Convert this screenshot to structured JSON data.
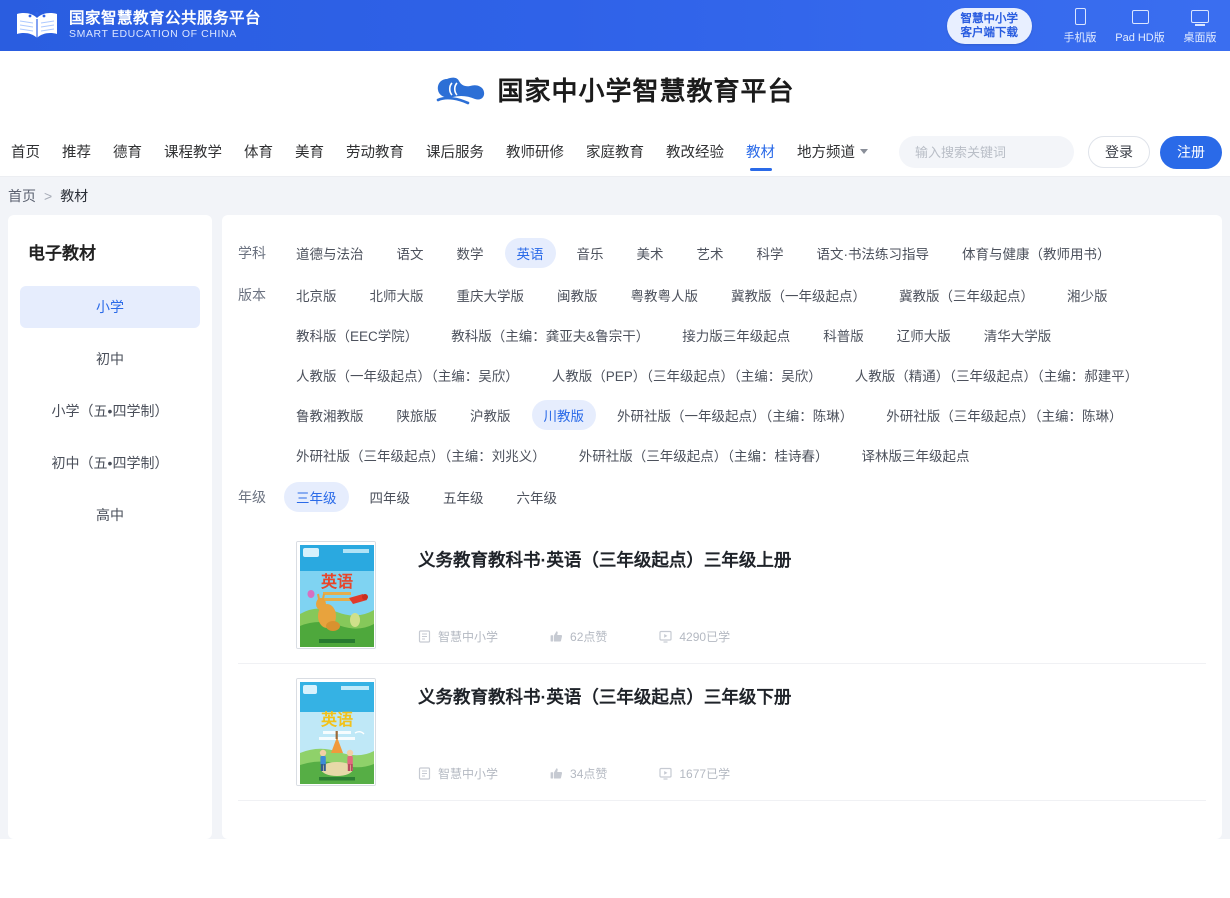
{
  "topbar": {
    "title_cn": "国家智慧教育公共服务平台",
    "title_en": "SMART EDUCATION OF CHINA",
    "client_line1": "智慧中小学",
    "client_line2": "客户端下载",
    "devices": [
      {
        "label": "手机版",
        "icon": "phone-icon"
      },
      {
        "label": "Pad HD版",
        "icon": "tablet-icon"
      },
      {
        "label": "桌面版",
        "icon": "desktop-icon"
      }
    ]
  },
  "header": {
    "brand": "国家中小学智慧教育平台",
    "logo_icon": "cloud-wave-logo"
  },
  "nav": {
    "items": [
      {
        "label": "首页",
        "active": false
      },
      {
        "label": "推荐",
        "active": false
      },
      {
        "label": "德育",
        "active": false
      },
      {
        "label": "课程教学",
        "active": false
      },
      {
        "label": "体育",
        "active": false
      },
      {
        "label": "美育",
        "active": false
      },
      {
        "label": "劳动教育",
        "active": false
      },
      {
        "label": "课后服务",
        "active": false
      },
      {
        "label": "教师研修",
        "active": false
      },
      {
        "label": "家庭教育",
        "active": false
      },
      {
        "label": "教改经验",
        "active": false
      },
      {
        "label": "教材",
        "active": true
      },
      {
        "label": "地方频道",
        "active": false,
        "has_caret": true
      }
    ],
    "search_placeholder": "输入搜索关键词",
    "search_value": "",
    "login_label": "登录",
    "register_label": "注册"
  },
  "breadcrumb": {
    "home": "首页",
    "separator": ">",
    "current": "教材"
  },
  "sidebar": {
    "title": "电子教材",
    "items": [
      {
        "label": "小学",
        "active": true
      },
      {
        "label": "初中",
        "active": false
      },
      {
        "label": "小学（五•四学制）",
        "active": false
      },
      {
        "label": "初中（五•四学制）",
        "active": false
      },
      {
        "label": "高中",
        "active": false
      }
    ]
  },
  "filters": [
    {
      "label": "学科",
      "options": [
        {
          "text": "道德与法治",
          "selected": false
        },
        {
          "text": "语文",
          "selected": false
        },
        {
          "text": "数学",
          "selected": false
        },
        {
          "text": "英语",
          "selected": true
        },
        {
          "text": "音乐",
          "selected": false
        },
        {
          "text": "美术",
          "selected": false
        },
        {
          "text": "艺术",
          "selected": false
        },
        {
          "text": "科学",
          "selected": false
        },
        {
          "text": "语文·书法练习指导",
          "selected": false
        },
        {
          "text": "体育与健康（教师用书）",
          "selected": false
        }
      ]
    },
    {
      "label": "版本",
      "options": [
        {
          "text": "北京版",
          "selected": false
        },
        {
          "text": "北师大版",
          "selected": false
        },
        {
          "text": "重庆大学版",
          "selected": false
        },
        {
          "text": "闽教版",
          "selected": false
        },
        {
          "text": "粤教粤人版",
          "selected": false
        },
        {
          "text": "冀教版（一年级起点）",
          "selected": false
        },
        {
          "text": "冀教版（三年级起点）",
          "selected": false
        },
        {
          "text": "湘少版",
          "selected": false
        },
        {
          "text": "教科版（EEC学院）",
          "selected": false
        },
        {
          "text": "教科版（主编：龚亚夫&鲁宗干）",
          "selected": false
        },
        {
          "text": "接力版三年级起点",
          "selected": false
        },
        {
          "text": "科普版",
          "selected": false
        },
        {
          "text": "辽师大版",
          "selected": false
        },
        {
          "text": "清华大学版",
          "selected": false
        },
        {
          "text": "人教版（一年级起点）（主编：吴欣）",
          "selected": false
        },
        {
          "text": "人教版（PEP）（三年级起点）（主编：吴欣）",
          "selected": false
        },
        {
          "text": "人教版（精通）（三年级起点）（主编：郝建平）",
          "selected": false
        },
        {
          "text": "鲁教湘教版",
          "selected": false
        },
        {
          "text": "陕旅版",
          "selected": false
        },
        {
          "text": "沪教版",
          "selected": false
        },
        {
          "text": "川教版",
          "selected": true
        },
        {
          "text": "外研社版（一年级起点）（主编：陈琳）",
          "selected": false
        },
        {
          "text": "外研社版（三年级起点）（主编：陈琳）",
          "selected": false
        },
        {
          "text": "外研社版（三年级起点）（主编：刘兆义）",
          "selected": false
        },
        {
          "text": "外研社版（三年级起点）（主编：桂诗春）",
          "selected": false
        },
        {
          "text": "译林版三年级起点",
          "selected": false
        }
      ]
    },
    {
      "label": "年级",
      "options": [
        {
          "text": "三年级",
          "selected": true
        },
        {
          "text": "四年级",
          "selected": false
        },
        {
          "text": "五年级",
          "selected": false
        },
        {
          "text": "六年级",
          "selected": false
        }
      ]
    }
  ],
  "books": [
    {
      "title": "义务教育教科书·英语（三年级起点）三年级上册",
      "source": "智慧中小学",
      "likes": "62点赞",
      "studied": "4290已学",
      "cover_subject": "英语",
      "cover_style": "kangaroo"
    },
    {
      "title": "义务教育教科书·英语（三年级起点）三年级下册",
      "source": "智慧中小学",
      "likes": "34点赞",
      "studied": "1677已学",
      "cover_subject": "英语",
      "cover_style": "children"
    }
  ],
  "colors": {
    "brand_blue": "#2a6ae8",
    "topbar_blue": "#2f62e8",
    "chip_selected_bg": "#e6edfd"
  }
}
